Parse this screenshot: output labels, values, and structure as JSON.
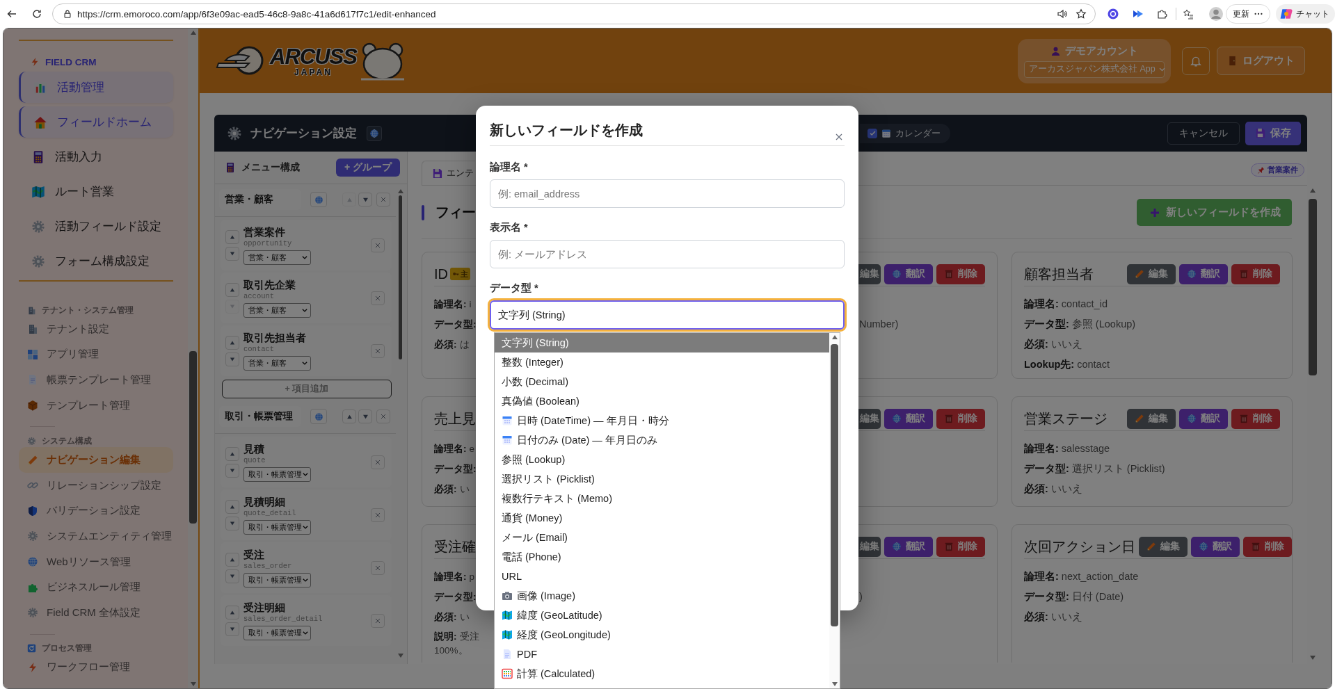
{
  "browser": {
    "url": "https://crm.emoroco.com/app/6f3e09ac-ead5-46c8-9a8c-41a6d617f7c1/edit-enhanced",
    "update_label": "更新",
    "chat_label": "チャット"
  },
  "sidebar": {
    "sections": [
      {
        "title": "FIELD CRM",
        "kind": "brand",
        "items": [
          {
            "label": "活動管理",
            "highlighted": true,
            "selected": false
          },
          {
            "label": "フィールドホーム",
            "highlighted": true,
            "selected": false
          },
          {
            "label": "活動入力",
            "highlighted": false,
            "selected": false
          },
          {
            "label": "ルート営業",
            "highlighted": false,
            "selected": false
          },
          {
            "label": "活動フィールド設定",
            "highlighted": false,
            "selected": false
          },
          {
            "label": "フォーム構成設定",
            "highlighted": false,
            "selected": false
          }
        ]
      },
      {
        "title": "テナント・システム管理",
        "kind": "group",
        "items": [
          {
            "label": "テナント設定",
            "highlighted": false,
            "selected": false
          },
          {
            "label": "アプリ管理",
            "highlighted": false,
            "selected": false
          },
          {
            "label": "帳票テンプレート管理",
            "highlighted": false,
            "selected": false
          },
          {
            "label": "テンプレート管理",
            "highlighted": false,
            "selected": false
          }
        ]
      },
      {
        "title": "システム構成",
        "kind": "group",
        "items": [
          {
            "label": "ナビゲーション編集",
            "highlighted": false,
            "selected": true
          },
          {
            "label": "リレーションシップ設定",
            "highlighted": false,
            "selected": false
          },
          {
            "label": "バリデーション設定",
            "highlighted": false,
            "selected": false
          },
          {
            "label": "システムエンティティ管理",
            "highlighted": false,
            "selected": false
          },
          {
            "label": "Webリソース管理",
            "highlighted": false,
            "selected": false
          },
          {
            "label": "ビジネスルール管理",
            "highlighted": false,
            "selected": false
          },
          {
            "label": "Field CRM 全体設定",
            "highlighted": false,
            "selected": false
          }
        ]
      },
      {
        "title": "プロセス管理",
        "kind": "group",
        "items": [
          {
            "label": "ワークフロー管理",
            "highlighted": false,
            "selected": false
          }
        ]
      }
    ]
  },
  "header": {
    "logo_title": "ARCUSS",
    "logo_subtitle": "JAPAN",
    "account_name": "デモアカウント",
    "app_select": "アーカスジャパン株式会社 App",
    "logout": "ログアウト"
  },
  "navigation": {
    "title": "ナビゲーション設定",
    "toggles": [
      {
        "label": "カレンダー",
        "checked": true
      }
    ],
    "cancel": "キャンセル",
    "save": "保存"
  },
  "menu": {
    "title": "メニュー構成",
    "add_group": "+ グループ",
    "groups": [
      {
        "name": "営業・顧客",
        "up_disabled": true,
        "add_item": "+ 項目追加",
        "items": [
          {
            "label": "営業案件",
            "key": "opportunity",
            "group": "営業・顧客",
            "down_disabled": false
          },
          {
            "label": "取引先企業",
            "key": "account",
            "group": "営業・顧客",
            "down_disabled": true
          },
          {
            "label": "取引先担当者",
            "key": "contact",
            "group": "営業・顧客",
            "down_disabled": false
          }
        ]
      },
      {
        "name": "取引・帳票管理",
        "up_disabled": false,
        "items": [
          {
            "label": "見積",
            "key": "quote",
            "group": "取引・帳票管理",
            "down_disabled": false
          },
          {
            "label": "見積明細",
            "key": "quote_detail",
            "group": "取引・帳票管理",
            "down_disabled": false
          },
          {
            "label": "受注",
            "key": "sales_order",
            "group": "取引・帳票管理",
            "down_disabled": false
          },
          {
            "label": "受注明細",
            "key": "sales_order_detail",
            "group": "取引・帳票管理",
            "down_disabled": false
          }
        ]
      }
    ]
  },
  "fields": {
    "tab": "エンテ",
    "pin": "営業案件",
    "heading": "フィー",
    "new_button": "新しいフィールドを作成",
    "cards": [
      {
        "kind": "left",
        "title": "ID",
        "badge": "主",
        "lines": [
          {
            "label": "論理名:",
            "value": "i"
          },
          {
            "label": "データ型:"
          },
          {
            "label": "必須:",
            "value": "は"
          }
        ]
      },
      {
        "kind": "right",
        "buttons": [
          {
            "kind": "edit",
            "label": "編集"
          },
          {
            "kind": "translate",
            "label": "翻訳"
          },
          {
            "kind": "delete",
            "label": "削除"
          }
        ],
        "lines": [
          {
            "value": "Number)"
          }
        ]
      },
      {
        "kind": "whole",
        "title": "顧客担当者",
        "buttons": [
          {
            "kind": "edit",
            "label": "編集"
          },
          {
            "kind": "translate",
            "label": "翻訳"
          },
          {
            "kind": "delete",
            "label": "削除"
          }
        ],
        "lines": [
          {
            "label": "論理名:",
            "value": "contact_id"
          },
          {
            "label": "データ型:",
            "value": "参照 (Lookup)"
          },
          {
            "label": "必須:",
            "value": "いいえ"
          },
          {
            "label": "Lookup先:",
            "value": "contact"
          }
        ]
      },
      {
        "kind": "left",
        "title": "売上見",
        "lines": [
          {
            "label": "論理名:",
            "value": "e"
          },
          {
            "label": "データ型:"
          },
          {
            "label": "必須:",
            "value": "い"
          }
        ]
      },
      {
        "kind": "right",
        "buttons": [
          {
            "kind": "edit",
            "label": "編集"
          },
          {
            "kind": "translate",
            "label": "翻訳"
          },
          {
            "kind": "delete",
            "label": "削除"
          }
        ]
      },
      {
        "kind": "whole",
        "title": "営業ステージ",
        "buttons": [
          {
            "kind": "edit",
            "label": "編集"
          },
          {
            "kind": "translate",
            "label": "翻訳"
          },
          {
            "kind": "delete",
            "label": "削除"
          }
        ],
        "lines": [
          {
            "label": "論理名:",
            "value": "salesstage"
          },
          {
            "label": "データ型:",
            "value": "選択リスト (Picklist)"
          },
          {
            "label": "必須:",
            "value": "いいえ"
          }
        ]
      },
      {
        "kind": "left",
        "title": "受注確",
        "lines": [
          {
            "label": "論理名:",
            "value": "p"
          },
          {
            "label": "データ型:"
          },
          {
            "label": "必須:",
            "value": "い"
          }
        ],
        "description": {
          "label": "説明:",
          "value": "受注\n100%。"
        }
      },
      {
        "kind": "right",
        "buttons": [
          {
            "kind": "edit",
            "label": "編集"
          },
          {
            "kind": "translate",
            "label": "翻訳"
          },
          {
            "kind": "delete",
            "label": "削除"
          }
        ],
        "lines": [
          {
            "value": ")"
          }
        ]
      },
      {
        "kind": "whole",
        "title": "次回アクション日",
        "buttons": [
          {
            "kind": "edit",
            "label": "編集"
          },
          {
            "kind": "translate",
            "label": "翻訳"
          },
          {
            "kind": "delete",
            "label": "削除"
          }
        ],
        "lines": [
          {
            "label": "論理名:",
            "value": "next_action_date"
          },
          {
            "label": "データ型:",
            "value": "日付 (Date)"
          },
          {
            "label": "必須:",
            "value": "いいえ"
          }
        ]
      }
    ]
  },
  "modal": {
    "title": "新しいフィールドを作成",
    "fields": [
      {
        "kind": "input",
        "label": "論理名 *",
        "placeholder": "例: email_address"
      },
      {
        "kind": "input",
        "label": "表示名 *",
        "placeholder": "例: メールアドレス"
      },
      {
        "kind": "select",
        "label": "データ型 *",
        "value": "文字列 (String)"
      }
    ],
    "options": [
      {
        "label": "文字列 (String)",
        "kind": "text",
        "selected": true
      },
      {
        "label": "整数 (Integer)",
        "kind": "text",
        "selected": false
      },
      {
        "label": "小数 (Decimal)",
        "kind": "text",
        "selected": false
      },
      {
        "label": "真偽値 (Boolean)",
        "kind": "text",
        "selected": false
      },
      {
        "label": "日時 (DateTime) — 年月日・時分",
        "kind": "date",
        "selected": false
      },
      {
        "label": "日付のみ (Date) — 年月日のみ",
        "kind": "date",
        "selected": false
      },
      {
        "label": "参照 (Lookup)",
        "kind": "text",
        "selected": false
      },
      {
        "label": "選択リスト (Picklist)",
        "kind": "text",
        "selected": false
      },
      {
        "label": "複数行テキスト (Memo)",
        "kind": "text",
        "selected": false
      },
      {
        "label": "通貨 (Money)",
        "kind": "text",
        "selected": false
      },
      {
        "label": "メール (Email)",
        "kind": "text",
        "selected": false
      },
      {
        "label": "電話 (Phone)",
        "kind": "text",
        "selected": false
      },
      {
        "label": "URL",
        "kind": "text",
        "selected": false
      },
      {
        "label": "画像 (Image)",
        "kind": "image",
        "selected": false
      },
      {
        "label": "緯度 (GeoLatitude)",
        "kind": "geo",
        "selected": false
      },
      {
        "label": "経度 (GeoLongitude)",
        "kind": "geo",
        "selected": false
      },
      {
        "label": "PDF",
        "kind": "file",
        "selected": false
      },
      {
        "label": "計算 (Calculated)",
        "kind": "calc",
        "selected": false
      }
    ]
  }
}
